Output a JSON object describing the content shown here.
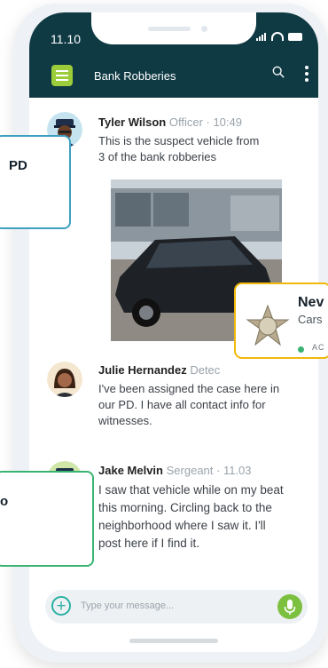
{
  "status_bar": {
    "time": "11.10"
  },
  "header": {
    "title": "Bank Robberies"
  },
  "messages": [
    {
      "name": "Tyler Wilson",
      "meta": "Officer · 10:49",
      "lines": [
        "This is the suspect vehicle from",
        "3 of the bank robberies"
      ]
    },
    {
      "name": "Julie Hernandez",
      "meta": "Detec",
      "lines": [
        "I've been assigned the case here in",
        "our PD. I have all contact info for",
        "witnesses."
      ]
    },
    {
      "name": "Jake Melvin",
      "meta": "Sergeant · 11.03",
      "lines": [
        "I saw that vehicle while on my beat",
        "this morning. Circling back to the",
        "neighborhood where I saw it. I'll",
        "post here if I find it."
      ]
    }
  ],
  "composer": {
    "placeholder": "Type your message..."
  },
  "cards": {
    "pd": "PD",
    "o": "o",
    "nev_name": "Nev",
    "nev_sub": "Cars",
    "nev_status": "AC"
  },
  "colors": {
    "header_bg": "#0f3a44",
    "accent_green": "#9ccc3a",
    "mic": "#7cc040",
    "teal": "#29b0a4"
  }
}
